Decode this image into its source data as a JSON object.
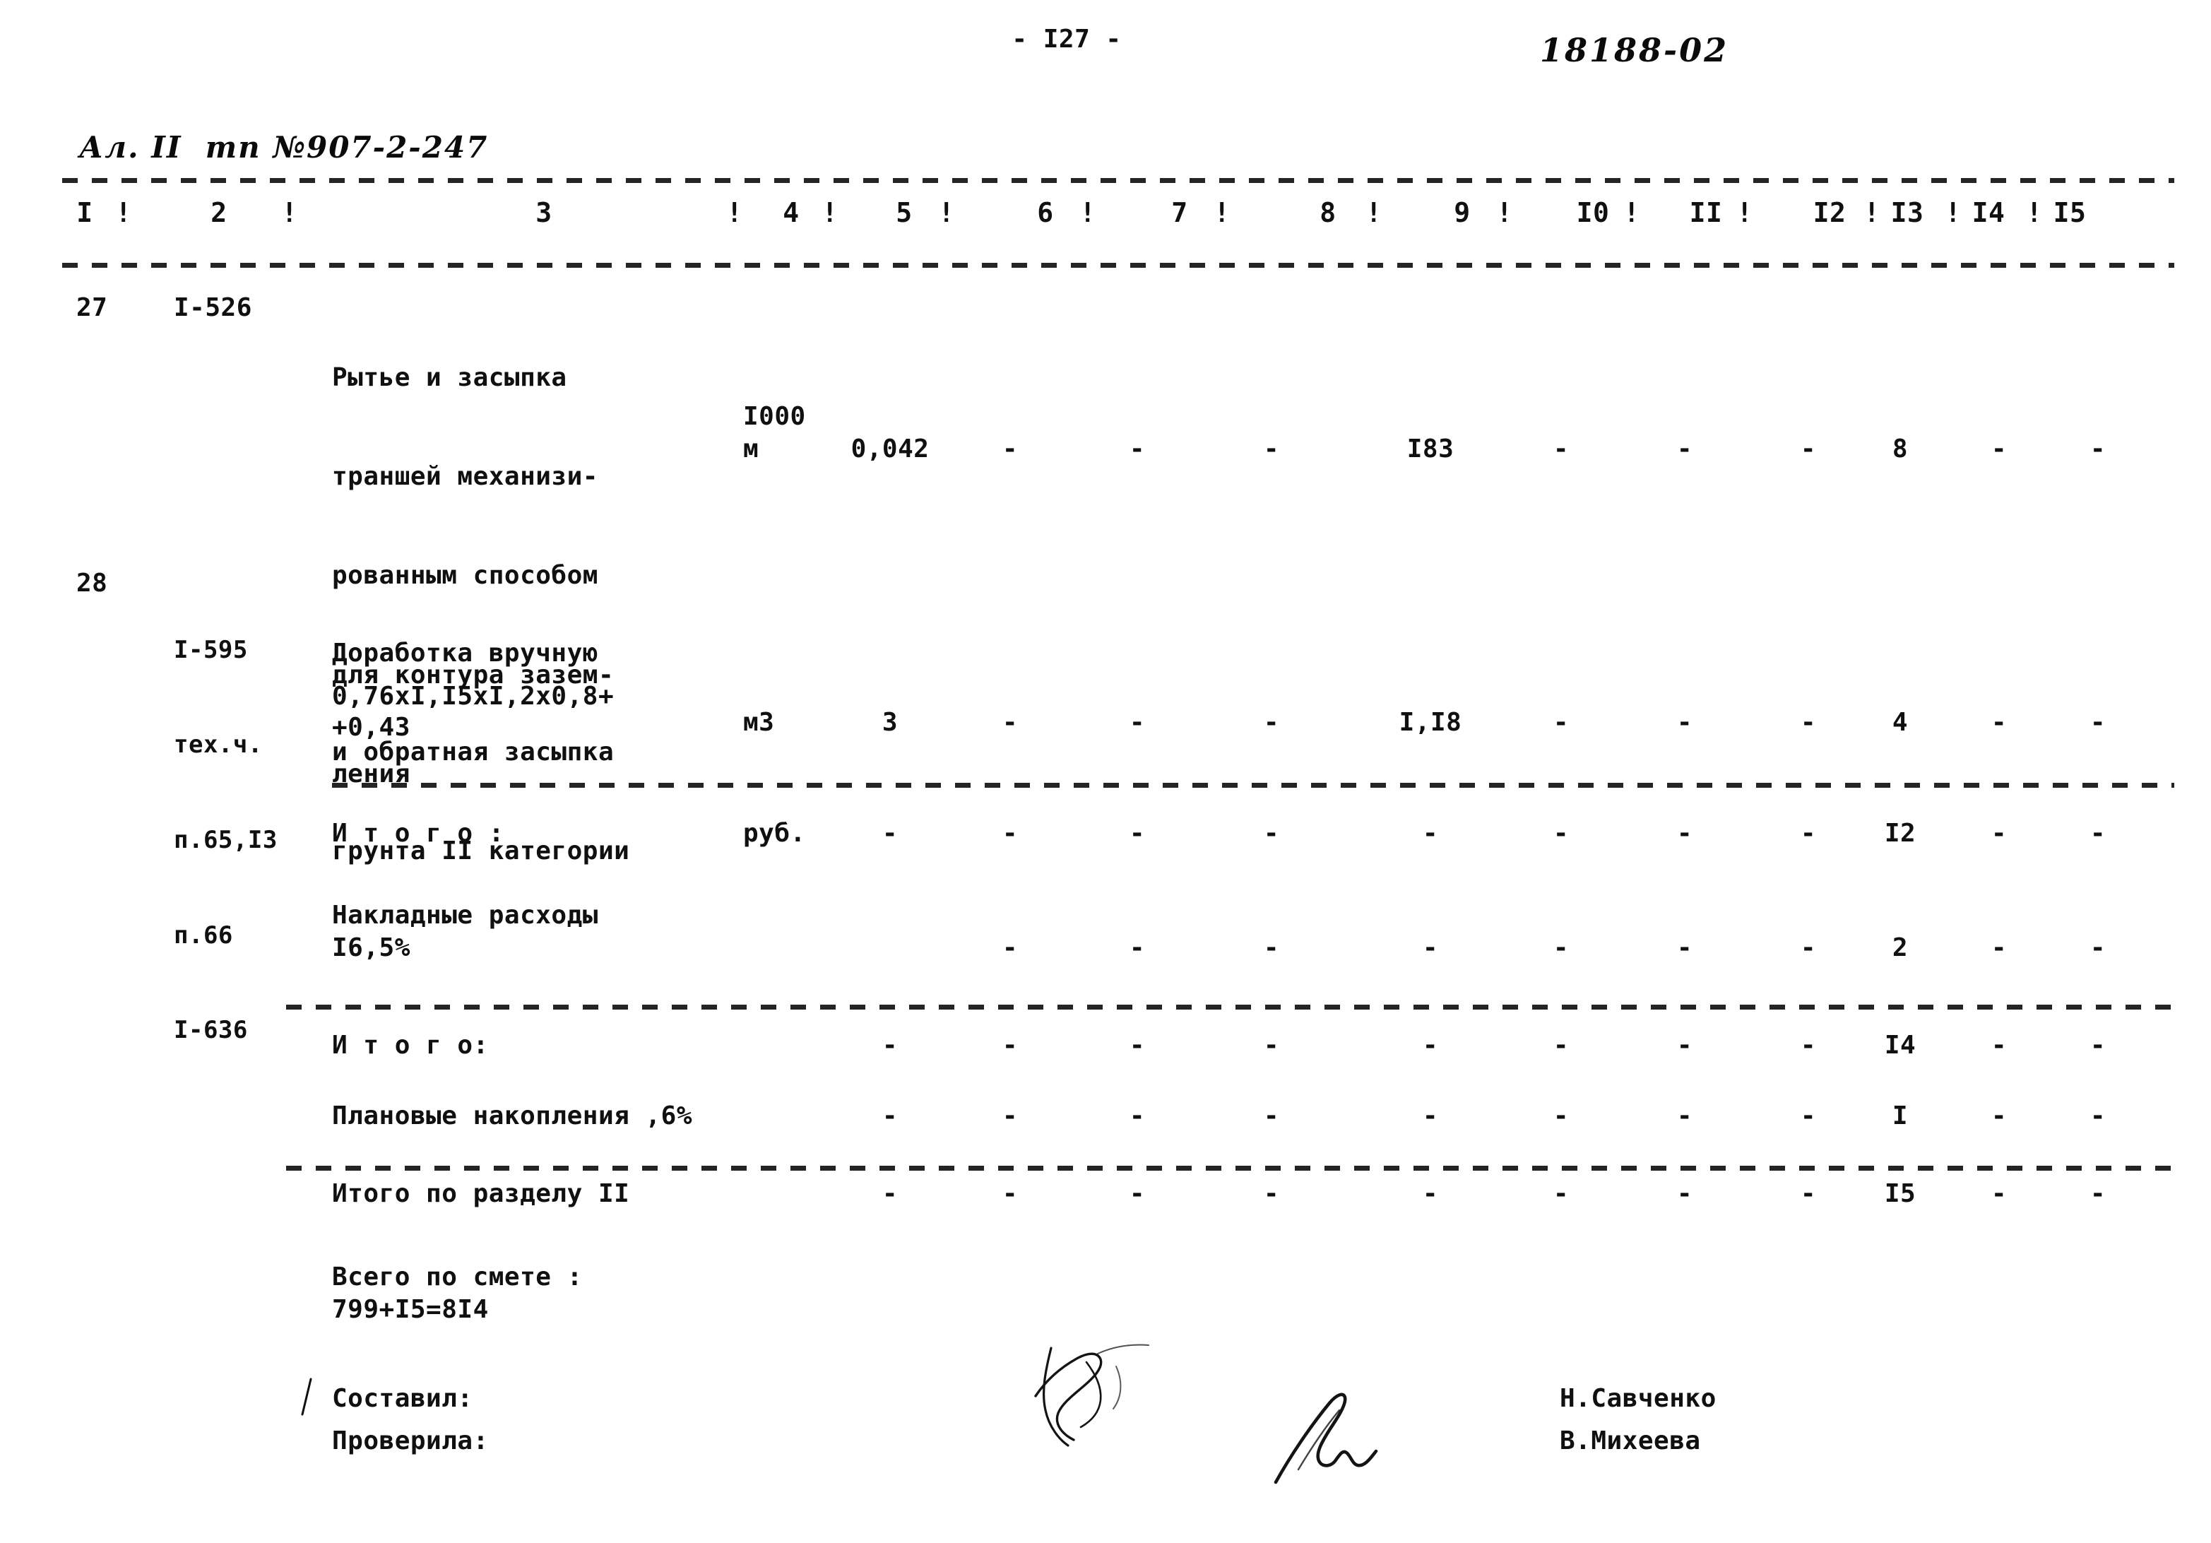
{
  "document": {
    "page_number": "- I27 -",
    "archive_code": "18188-02",
    "handwritten_header": "Ал. II  тп №907-2-247"
  },
  "table": {
    "column_headers": [
      "I",
      "2",
      "3",
      "4",
      "5",
      "6",
      "7",
      "8",
      "9",
      "I0",
      "II",
      "I2",
      "I3",
      "I4",
      "I5"
    ],
    "separator": "!",
    "rows": [
      {
        "id": "row-27",
        "num": "27",
        "code_lines": [
          "I-526"
        ],
        "description_lines": [
          "Рытье и засыпка",
          "траншей механизи-",
          "рованным способом",
          "для контура зазем-",
          "ления"
        ],
        "unit_lines": [
          "I000",
          "м"
        ],
        "c5": "0,042",
        "c6": "-",
        "c7": "-",
        "c8": "-",
        "c9": "I83",
        "c10": "-",
        "c11": "-",
        "c12": "-",
        "c13": "8",
        "c14": "-",
        "c15": "-"
      },
      {
        "id": "row-28",
        "num": "28",
        "code_lines": [
          "I-595",
          "тех.ч.",
          "п.65,I3",
          "п.66",
          "I-636"
        ],
        "description_lines": [
          "Доработка вручную",
          "и обратная засыпка",
          "грунта II категории",
          "0,76xI,I5xI,2x0,8+",
          "+0,43"
        ],
        "unit_lines": [
          "м3"
        ],
        "c5": "3",
        "c6": "-",
        "c7": "-",
        "c8": "-",
        "c9": "I,I8",
        "c10": "-",
        "c11": "-",
        "c12": "-",
        "c13": "4",
        "c14": "-",
        "c15": "-"
      }
    ],
    "summary_rows": [
      {
        "id": "summary-itogo-1",
        "label": "И т о г о :",
        "label2": "",
        "unit": "руб.",
        "c5": "-",
        "c6": "-",
        "c7": "-",
        "c8": "-",
        "c9": "-",
        "c10": "-",
        "c11": "-",
        "c12": "-",
        "c13": "I2",
        "c14": "-",
        "c15": "-"
      },
      {
        "id": "summary-overheads",
        "label": "Накладные расходы",
        "label2": "I6,5%",
        "unit": "",
        "c5": "",
        "c6": "-",
        "c7": "-",
        "c8": "-",
        "c9": "-",
        "c10": "-",
        "c11": "-",
        "c12": "-",
        "c13": "2",
        "c14": "-",
        "c15": "-"
      },
      {
        "id": "summary-itogo-2",
        "label": "И т о г о:",
        "label2": "",
        "unit": "",
        "c5": "-",
        "c6": "-",
        "c7": "-",
        "c8": "-",
        "c9": "-",
        "c10": "-",
        "c11": "-",
        "c12": "-",
        "c13": "I4",
        "c14": "-",
        "c15": "-"
      },
      {
        "id": "summary-planned-savings",
        "label": "Плановые накопления ,6%",
        "label2": "",
        "unit": "",
        "c5": "-",
        "c6": "-",
        "c7": "-",
        "c8": "-",
        "c9": "-",
        "c10": "-",
        "c11": "-",
        "c12": "-",
        "c13": "I",
        "c14": "-",
        "c15": "-"
      },
      {
        "id": "summary-section-total",
        "label": "Итого по разделу II",
        "label2": "",
        "unit": "",
        "c5": "-",
        "c6": "-",
        "c7": "-",
        "c8": "-",
        "c9": "-",
        "c10": "-",
        "c11": "-",
        "c12": "-",
        "c13": "I5",
        "c14": "-",
        "c15": "-"
      }
    ],
    "grand_total": {
      "label": "Всего по смете :",
      "value": "799+I5=8I4"
    }
  },
  "signatures": {
    "compiled_by_label": "Составил:",
    "checked_by_label": "Проверила:",
    "compiled_by_name": "Н.Савченко",
    "checked_by_name": "В.Михеева"
  }
}
